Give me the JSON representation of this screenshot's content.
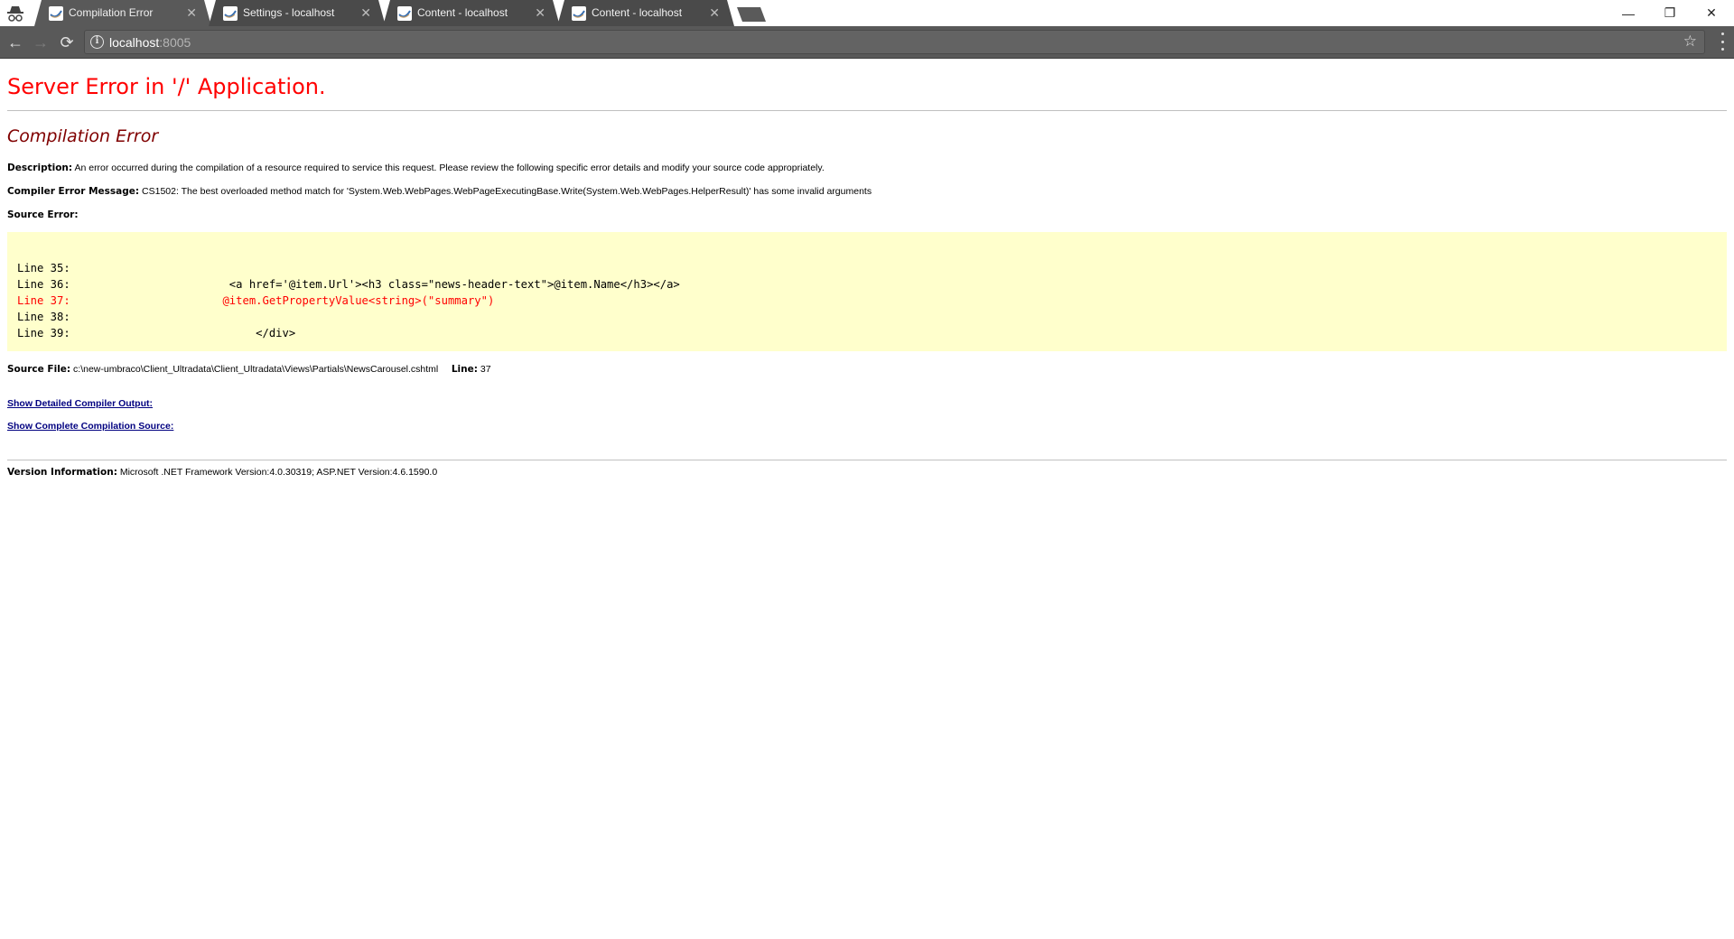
{
  "browser": {
    "tabs": [
      {
        "title": "Compilation Error",
        "active": true
      },
      {
        "title": "Settings - localhost",
        "active": false
      },
      {
        "title": "Content - localhost",
        "active": false
      },
      {
        "title": "Content - localhost",
        "active": false
      }
    ],
    "tab_close_glyph": "✕",
    "address": {
      "host": "localhost",
      "port": ":8005"
    },
    "icons": {
      "incognito": "incognito-icon",
      "back": "←",
      "forward": "→",
      "reload": "⟳",
      "info": "i",
      "star": "☆",
      "minimize": "—",
      "restore": "❐",
      "close": "✕"
    }
  },
  "page": {
    "title": "Server Error in '/' Application.",
    "subtitle": "Compilation Error",
    "description_label": "Description:",
    "description": " An error occurred during the compilation of a resource required to service this request. Please review the following specific error details and modify your source code appropriately.",
    "compiler_message_label": "Compiler Error Message:",
    "compiler_message": " CS1502: The best overloaded method match for 'System.Web.WebPages.WebPageExecutingBase.Write(System.Web.WebPages.HelperResult)' has some invalid arguments",
    "source_error_label": "Source Error:",
    "source_lines": [
      {
        "label": "Line 35:",
        "code": "",
        "error": false
      },
      {
        "label": "Line 36:",
        "code": "                        <a href='@item.Url'><h3 class=\"news-header-text\">@item.Name</h3></a>",
        "error": false
      },
      {
        "label": "Line 37:",
        "code": "                       @item.GetPropertyValue<string>(\"summary\")",
        "error": true
      },
      {
        "label": "Line 38:",
        "code": "",
        "error": false
      },
      {
        "label": "Line 39:",
        "code": "                            </div>",
        "error": false
      }
    ],
    "source_file_label": "Source File:",
    "source_file": " c:\\new-umbraco\\Client_Ultradata\\Client_Ultradata\\Views\\Partials\\NewsCarousel.cshtml",
    "line_label": "Line:",
    "line_value": " 37",
    "links": {
      "detailed_output": "Show Detailed Compiler Output:",
      "complete_source": "Show Complete Compilation Source:"
    },
    "version_label": "Version Information:",
    "version": " Microsoft .NET Framework Version:4.0.30319; ASP.NET Version:4.6.1590.0"
  },
  "colors": {
    "title_red": "#ff0000",
    "subtitle_maroon": "#800000",
    "code_bg": "#ffffcc",
    "link_navy": "#000080",
    "toolbar": "#595959"
  }
}
